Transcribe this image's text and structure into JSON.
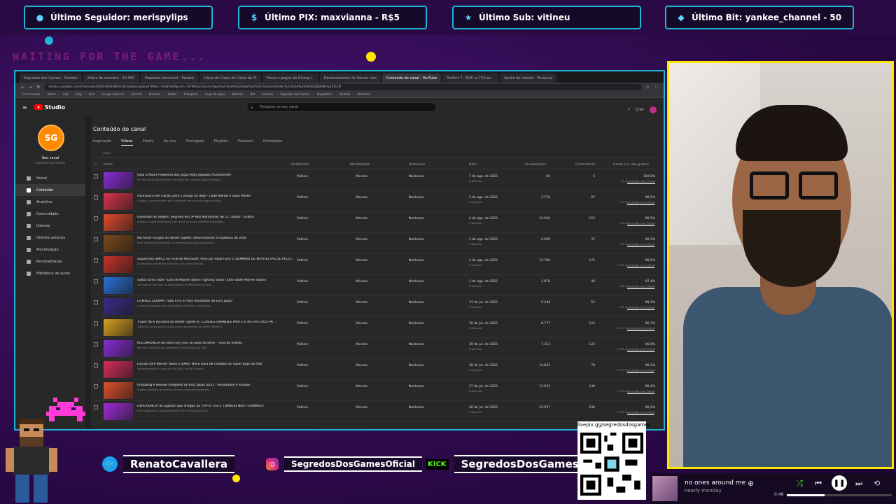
{
  "overlay": {
    "alerts": [
      {
        "label": "Último Seguidor: merispylips",
        "icon": "user-icon"
      },
      {
        "label": "Último PIX: maxvianna - R$5",
        "icon": "dollar-icon"
      },
      {
        "label": "Último Sub: vitineu",
        "icon": "star-icon"
      },
      {
        "label": "Último Bit: yankee_channel - 50",
        "icon": "gem-icon"
      }
    ],
    "waiting_text": "WAITING FOR THE GAME...",
    "qr_label": "livepix.gg/segredosdosgames",
    "social": {
      "twitter": "RenatoCavallera",
      "instagram": "SegredosDosGamesOficial",
      "kick_badge": "KICK",
      "kick": "SegredosDosGames"
    },
    "music": {
      "song": "no ones around me",
      "artist": "nearly monday",
      "time": "0:48",
      "progress": 0.36
    },
    "colors": {
      "accent": "#1fb3d8",
      "cam_border": "#ffe600",
      "neon": "#ff3aa8"
    }
  },
  "browser": {
    "tabs": [
      "Segredos dos Games - Dashbo",
      "Zebra de amostra - 50.000",
      "Proposta comercial - Renato",
      "Cópia de Cópia de Cópia de Pr",
      "Pesos e pegos do Disney+",
      "Desenvolvedor do Server rum",
      "Conteúdo do canal - YouTube",
      "Perfect 7 - N2K vs T2K ex",
      "lambe de moeda - Pesquisa"
    ],
    "active_tab": 6,
    "url": "studio.youtube.com/channel/UCKtGVA0EHRO1tQi/videos/upload?filter=%5B%5D&sort=%7B%22columnType%22%3A%22date%22%2C%22sortOrder%22%3A%22DESCENDING%22%7D",
    "bookmarks": [
      "Ferramentas",
      "Twitch",
      "Loja",
      "Blog",
      "Kick",
      "Google AdSense",
      "Discord",
      "Streams",
      "Twitter",
      "Instagram",
      "Lojas de jogos",
      "Notícias",
      "Bot",
      "Amazon",
      "Segredos dos Games",
      "Playstation",
      "Youtube",
      "Nintendo"
    ]
  },
  "studio": {
    "logo": "Studio",
    "search_placeholder": "Pesquise no seu canal",
    "create_label": "Criar",
    "channel_initials": "SG",
    "channel_name": "Seu canal",
    "channel_sub": "Segredos dos Games",
    "nav": [
      "Painel",
      "Conteúdo",
      "Analytics",
      "Comunidade",
      "Idiomas",
      "Direitos autorais",
      "Monetização",
      "Personalização",
      "Biblioteca de áudio"
    ],
    "nav_active": 1,
    "page_title": "Conteúdo do canal",
    "tabs": [
      "Inspiração",
      "Vídeos",
      "Shorts",
      "Ao vivo",
      "Postagens",
      "Playlists",
      "Podcasts",
      "Promoções"
    ],
    "tab_active": 1,
    "filter_label": "Filtrar",
    "columns": [
      "Vídeo",
      "Visibilidade",
      "Monetização",
      "Restrições",
      "Data",
      "Visualizações",
      "Comentários",
      "Gostei (vs. não gostei)"
    ],
    "rows": [
      {
        "title": "Qual o Maior Problema dos Jogos Mais Jogados Atualmente?",
        "desc": "Por que tanto gente prefere só voltar aos mesmos jogos favoritos?",
        "vis": "Público",
        "mon": "Ativado",
        "res": "Nenhuma",
        "date": "7 de ago. de 2025",
        "status": "Publicado",
        "views": "46",
        "comments": "5",
        "likes": "100,0%",
        "likes_sub": "10 marcações com Gostei",
        "ratio": 1.0,
        "thumb": "#8a2bd8"
      },
      {
        "title": "Assinatura em Cartão para Coringa no Hoje - Cadê Mortal e Deus Marte!",
        "desc": "Chegou o grande trailer de Crunchyroll em um único jogo de bolsa...",
        "vis": "Público",
        "mon": "Ativado",
        "res": "Nenhuma",
        "date": "5 de ago. de 2025",
        "status": "Publicado",
        "views": "3.776",
        "comments": "97",
        "likes": "96,5%",
        "likes_sub": "213 marcações com Gostei",
        "ratio": 0.965,
        "thumb": "#d8344a"
      },
      {
        "title": "Extensão do Tekken: Segredo em 5ª Nós Maravilhas de 11 Títulos - Grátis!",
        "desc": "Chegou a nova atualização com todos os novos conteúdos liberados...",
        "vis": "Público",
        "mon": "Ativado",
        "res": "Nenhuma",
        "date": "4 de ago. de 2025",
        "status": "Publicado",
        "views": "10.626",
        "comments": "153",
        "likes": "96,5%",
        "likes_sub": "523 marcações com Gostei",
        "ratio": 0.965,
        "thumb": "#e04a2b"
      },
      {
        "title": "Microsoft e Jogos no Street Fighter: desvendando a trajetória da vida!",
        "desc": "Esse episódio mostra todas as etapas pelas quais passamos...",
        "vis": "Público",
        "mon": "Ativado",
        "res": "Nenhuma",
        "date": "3 de ago. de 2025",
        "status": "Publicado",
        "views": "6.000",
        "comments": "37",
        "likes": "96,5%",
        "likes_sub": "106 marcações com Gostei",
        "ratio": 0.965,
        "thumb": "#7a4a1a"
      },
      {
        "title": "Supernova SMIC2 no Final da Microsoft: feito por Fatal Fury! O DOMÍNIO DE MUITOS FÃS DE ACCO...",
        "desc": "Continuação da Marvel Fatal Fury City of the Wolves...",
        "vis": "Público",
        "mon": "Ativado",
        "res": "Nenhuma",
        "date": "2 de ago. de 2025",
        "status": "Publicado",
        "views": "12.796",
        "comments": "175",
        "likes": "96,5%",
        "likes_sub": "1.207 marcações com Gostei",
        "ratio": 0.965,
        "thumb": "#c7322a"
      },
      {
        "title": "Saiba como Fazer Tudo de Marvel Tokon: Fighting Souls (Tudo sobre Marvel Tokon)",
        "desc": "Um jogo de luta com os personagens da Marvel anunciado...",
        "vis": "Público",
        "mon": "Ativado",
        "res": "Nenhuma",
        "date": "1 de ago. de 2025",
        "status": "Publicado",
        "views": "2.876",
        "comments": "40",
        "likes": "97,4%",
        "likes_sub": "298 marcações com Gostei",
        "ratio": 0.974,
        "thumb": "#2b6fd8"
      },
      {
        "title": "CONVEZ ZEENAR: Fatal Fury e mais novidades do EVO Japan",
        "desc": "A nova temporada traz personagens inéditos e mudanças...",
        "vis": "Público",
        "mon": "Ativado",
        "res": "Nenhuma",
        "date": "31 de jul. de 2025",
        "status": "Publicado",
        "views": "5.244",
        "comments": "52",
        "likes": "98,1%",
        "likes_sub": "432 marcações com Gostei",
        "ratio": 0.981,
        "thumb": "#3b2a8a"
      },
      {
        "title": "Trailer do 6 Pyramid da Street Fighter 6: CLASSES GRANDES PARTE III de EVO 2025 PR...",
        "desc": "Trailer de personagens novos para a temporada de Street Fighter 6...",
        "vis": "Público",
        "mon": "Ativado",
        "res": "Nenhuma",
        "date": "30 de jul. de 2025",
        "status": "Publicado",
        "views": "8.777",
        "comments": "123",
        "likes": "96,7%",
        "likes_sub": "1.213 marcações com Gostei",
        "ratio": 0.967,
        "thumb": "#d8a01f"
      },
      {
        "title": "RECORRÊNCIA do Fatal Fury nos 30 anos da série - Tudo do evento",
        "desc": "Resumo completo das novidades anunciadas pela SNK...",
        "vis": "Público",
        "mon": "Ativado",
        "res": "Nenhuma",
        "date": "29 de jul. de 2025",
        "status": "Publicado",
        "views": "7.313",
        "comments": "122",
        "likes": "96,9%",
        "likes_sub": "1.060 marcações com Gostei",
        "ratio": 0.969,
        "thumb": "#8a2bd8"
      },
      {
        "title": "Estudo com Marvel Tokon e 2XKO: Novo Guia de Combos do Super Jogo da Riot",
        "desc": "Novidades sobre o jogo de luta 2XKO da Riot Games...",
        "vis": "Público",
        "mon": "Ativado",
        "res": "Nenhuma",
        "date": "28 de jul. de 2025",
        "status": "Publicado",
        "views": "14.832",
        "comments": "78",
        "likes": "96,2%",
        "likes_sub": "2.070 marcações com Gostei",
        "ratio": 0.962,
        "thumb": "#d82b5a"
      },
      {
        "title": "Unboxing e Review completo do EVO Japan 2025 - Resultados e Análise",
        "desc": "Análise completa do evento com os melhores momentos...",
        "vis": "Público",
        "mon": "Ativado",
        "res": "Nenhuma",
        "date": "27 de jul. de 2025",
        "status": "Publicado",
        "views": "13.931",
        "comments": "149",
        "likes": "96,4%",
        "likes_sub": "1.378 marcações com Gostei",
        "ratio": 0.964,
        "thumb": "#e0502b"
      },
      {
        "title": "EXPERIÊNCIA do jogador que chegou ao TOP 8 - ESTE TORNEIO NÃO TERMINOU!",
        "desc": "Entrevista com o jogador brasileiro que chegou ao top 8...",
        "vis": "Público",
        "mon": "Ativado",
        "res": "Nenhuma",
        "date": "26 de jul. de 2025",
        "status": "Publicado",
        "views": "22.937",
        "comments": "236",
        "likes": "96,0%",
        "likes_sub": "3.104 marcações com Gostei",
        "ratio": 0.96,
        "thumb": "#a02bd8"
      }
    ]
  }
}
